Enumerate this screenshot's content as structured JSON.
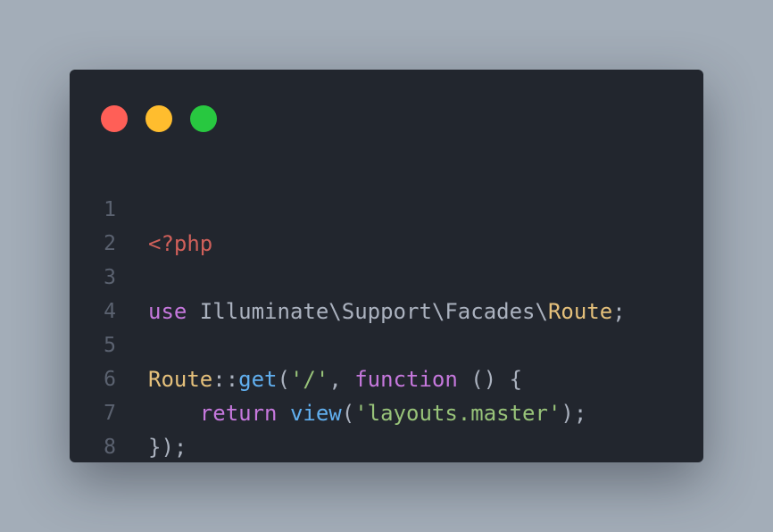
{
  "window_controls": {
    "close_color": "#ff5f57",
    "minimize_color": "#ffbd2e",
    "maximize_color": "#28c840"
  },
  "code": {
    "line_numbers": [
      "1",
      "2",
      "3",
      "4",
      "5",
      "6",
      "7",
      "8"
    ],
    "lines": [
      {
        "tokens": [
          {
            "t": "tag",
            "v": "<?php"
          }
        ]
      },
      {
        "tokens": []
      },
      {
        "tokens": [
          {
            "t": "kw",
            "v": "use"
          },
          {
            "t": "plain",
            "v": " Illuminate\\Support\\Facades\\"
          },
          {
            "t": "cls",
            "v": "Route"
          },
          {
            "t": "punct",
            "v": ";"
          }
        ]
      },
      {
        "tokens": []
      },
      {
        "tokens": [
          {
            "t": "cls",
            "v": "Route"
          },
          {
            "t": "punct",
            "v": "::"
          },
          {
            "t": "fn",
            "v": "get"
          },
          {
            "t": "punct",
            "v": "("
          },
          {
            "t": "str",
            "v": "'/'"
          },
          {
            "t": "punct",
            "v": ", "
          },
          {
            "t": "kw",
            "v": "function"
          },
          {
            "t": "punct",
            "v": " () {"
          }
        ]
      },
      {
        "tokens": [
          {
            "t": "plain",
            "v": "    "
          },
          {
            "t": "kw",
            "v": "return"
          },
          {
            "t": "plain",
            "v": " "
          },
          {
            "t": "fn",
            "v": "view"
          },
          {
            "t": "punct",
            "v": "("
          },
          {
            "t": "str",
            "v": "'layouts.master'"
          },
          {
            "t": "punct",
            "v": ");"
          }
        ]
      },
      {
        "tokens": [
          {
            "t": "punct",
            "v": "});"
          }
        ]
      },
      {
        "tokens": []
      }
    ]
  }
}
